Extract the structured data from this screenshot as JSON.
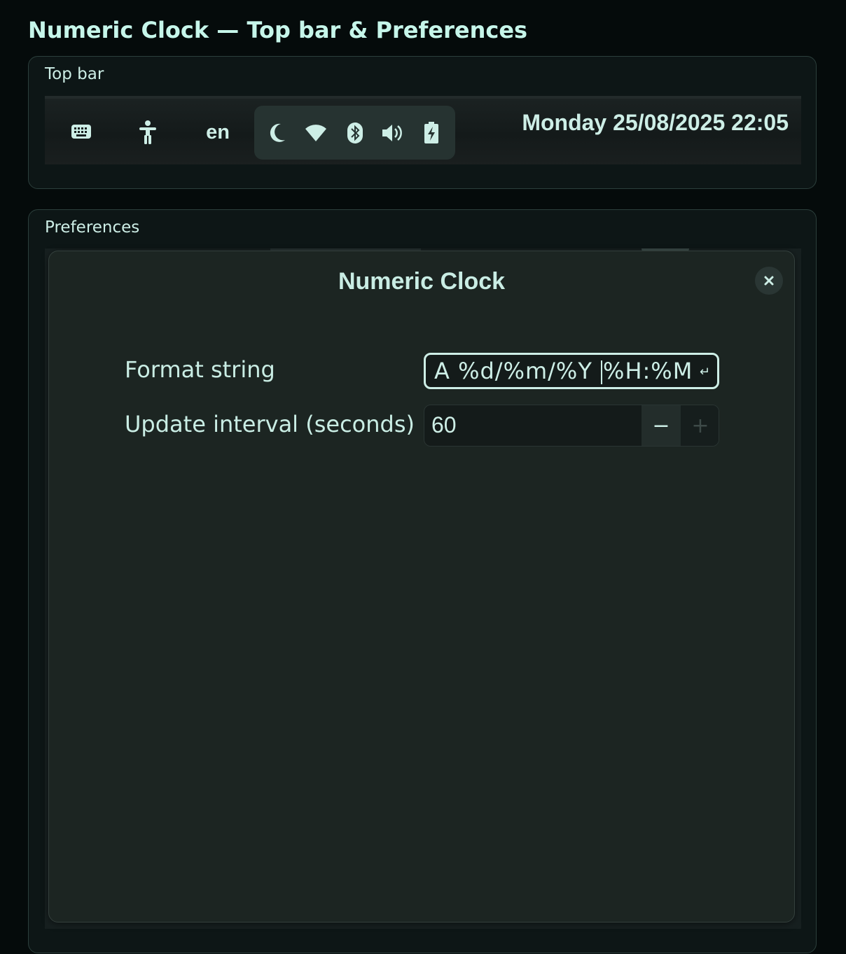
{
  "page": {
    "title": "Numeric Clock — Top bar & Preferences"
  },
  "topbar_section": {
    "label": "Top bar",
    "topbar": {
      "icons": [
        "keyboard-icon",
        "accessibility-icon"
      ],
      "language": "en",
      "status_icons": [
        "night-light-icon",
        "wifi-icon",
        "bluetooth-icon",
        "volume-icon",
        "battery-charging-icon"
      ],
      "clock": "Monday 25/08/2025 22:05"
    }
  },
  "prefs_section": {
    "label": "Preferences",
    "dialog": {
      "title": "Numeric Clock",
      "close_icon": "close-icon",
      "format_string": {
        "label": "Format string",
        "value_before_caret": "A %d/%m/%Y ",
        "value_after_caret": "%H:%M",
        "enter_glyph": "↵"
      },
      "update_interval": {
        "label": "Update interval (seconds)",
        "value": "60",
        "minus_label": "−",
        "plus_label": "+"
      }
    }
  },
  "colors": {
    "background": "#050b0b",
    "accent_text": "#c6f6ea",
    "dialog_bg": "#1c2522"
  }
}
